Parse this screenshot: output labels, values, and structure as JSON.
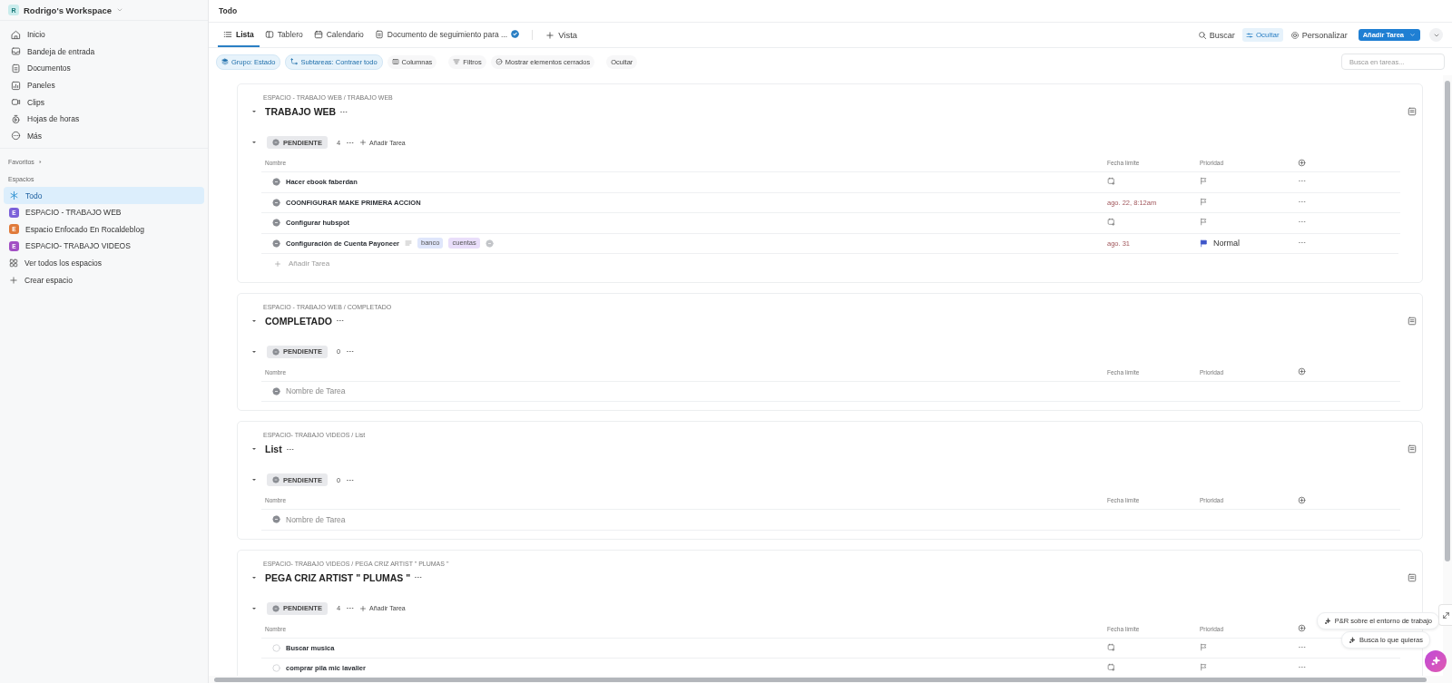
{
  "workspace": {
    "initial": "R",
    "name": "Rodrigo's Workspace"
  },
  "sidebar": {
    "items": [
      {
        "label": "Inicio"
      },
      {
        "label": "Bandeja de entrada"
      },
      {
        "label": "Documentos"
      },
      {
        "label": "Paneles"
      },
      {
        "label": "Clips"
      },
      {
        "label": "Hojas de horas"
      },
      {
        "label": "Más"
      }
    ],
    "favorites": "Favoritos",
    "spaces_heading": "Espacios",
    "spaces": [
      {
        "label": "Todo",
        "kind": "all",
        "selected": true
      },
      {
        "label": "ESPACIO - TRABAJO WEB",
        "kind": "space",
        "initial": "E",
        "color": "#7b61d9",
        "selected": false
      },
      {
        "label": "Espacio Enfocado En Rocaldeblog",
        "kind": "space",
        "initial": "E",
        "color": "#e07a3a",
        "selected": false
      },
      {
        "label": "ESPACIO- TRABAJO VIDEOS",
        "kind": "space",
        "initial": "E",
        "color": "#a24fc4",
        "selected": false
      }
    ],
    "links": [
      "Ver todos los espacios",
      "Crear espacio"
    ]
  },
  "breadcrumb": "Todo",
  "views": [
    {
      "label": "Lista",
      "selected": true
    },
    {
      "label": "Tablero",
      "selected": false
    },
    {
      "label": "Calendario",
      "selected": false
    },
    {
      "label": "Documento de seguimiento para ...",
      "selected": false
    }
  ],
  "add_view": "Vista",
  "actions": [
    {
      "label": "Buscar",
      "on": false
    },
    {
      "label": "Ocultar",
      "on": true
    },
    {
      "label": "Personalizar",
      "on": false
    }
  ],
  "primary_button": "Añadir Tarea",
  "filters": [
    {
      "label": "Grupo: Estado",
      "on": true
    },
    {
      "label": "Subtareas: Contraer todo",
      "on": true
    },
    {
      "label": "Columnas",
      "on": false
    },
    {
      "label": "Filtros",
      "on": false
    },
    {
      "label": "Mostrar elementos cerrados",
      "on": false
    },
    {
      "label": "Ocultar",
      "on": false
    }
  ],
  "task_search": {
    "placeholder": "Busca en tareas..."
  },
  "sections": [
    {
      "path": "ESPACIO - TRABAJO WEB / TRABAJO WEB",
      "title": "TRABAJO WEB",
      "expanded": true,
      "status": "PENDIENTE",
      "status_expanded": true,
      "count": "4",
      "add_label": "Añadir Tarea",
      "columns": [
        "Nombre",
        "Fecha límite",
        "Prioridad"
      ],
      "tasks": [
        {
          "name": "Hacer ebook faberdan",
          "filled": true
        },
        {
          "name": "COONFIGURAR MAKE PRIMERA ACCION",
          "filled": true,
          "due": "ago. 22, 8:12am"
        },
        {
          "name": "Configurar hubspot",
          "filled": true
        },
        {
          "name": "Configuración de Cuenta Payoneer",
          "filled": true,
          "tags": [
            {
              "label": "banco",
              "color": "#dfe6fb"
            },
            {
              "label": "cuentas",
              "color": "#e9defa"
            }
          ],
          "due": "ago. 31",
          "priority": "Normal"
        }
      ],
      "add_row": "Añadir Tarea"
    },
    {
      "path": "ESPACIO - TRABAJO WEB / COMPLETADO",
      "title": "COMPLETADO",
      "expanded": true,
      "status": "PENDIENTE",
      "status_expanded": true,
      "count": "0",
      "columns": [
        "Nombre",
        "Fecha límite",
        "Prioridad"
      ],
      "new_task": {
        "placeholder": "Nombre de Tarea"
      }
    },
    {
      "path": "ESPACIO- TRABAJO VIDEOS / List",
      "title": "List",
      "expanded": true,
      "status": "PENDIENTE",
      "status_expanded": true,
      "count": "0",
      "columns": [
        "Nombre",
        "Fecha límite",
        "Prioridad"
      ],
      "new_task": {
        "placeholder": "Nombre de Tarea"
      }
    },
    {
      "path": "ESPACIO- TRABAJO VIDEOS / PEGA CRIZ ARTIST \" PLUMAS \"",
      "title": "PEGA CRIZ ARTIST \" PLUMAS \"",
      "expanded": true,
      "status": "PENDIENTE",
      "status_expanded": true,
      "count": "4",
      "add_label": "Añadir Tarea",
      "columns": [
        "Nombre",
        "Fecha límite",
        "Prioridad"
      ],
      "tasks": [
        {
          "name": "Buscar musica",
          "filled": false
        },
        {
          "name": "comprar pila mic lavalier",
          "filled": false
        }
      ]
    }
  ],
  "assistant": [
    "P&R sobre el entorno de trabajo",
    "Busca lo que quieras"
  ]
}
